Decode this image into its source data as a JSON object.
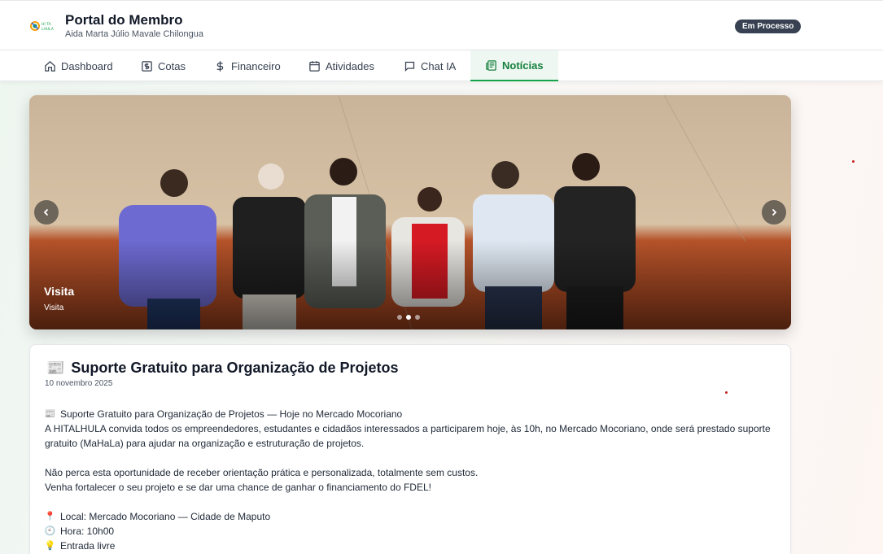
{
  "header": {
    "app_title": "Portal do Membro",
    "user_name": "Aida Marta Júlio Mavale Chilongua",
    "status": "Em Processo",
    "logo_text": "HITA LHULA"
  },
  "nav": {
    "tabs": [
      {
        "label": "Dashboard",
        "icon": "home-icon"
      },
      {
        "label": "Cotas",
        "icon": "dollar-square-icon"
      },
      {
        "label": "Financeiro",
        "icon": "dollar-icon"
      },
      {
        "label": "Atividades",
        "icon": "calendar-icon"
      },
      {
        "label": "Chat IA",
        "icon": "chat-icon"
      },
      {
        "label": "Notícias",
        "icon": "newspaper-icon",
        "active": true
      }
    ]
  },
  "carousel": {
    "title": "Visita",
    "caption": "Visita",
    "slide_count": 3,
    "active_slide": 2
  },
  "news": {
    "title": "Suporte Gratuito para Organização de Projetos",
    "date": "10 novembro 2025",
    "lines": [
      {
        "icon": "📰",
        "text": "Suporte Gratuito para Organização de Projetos — Hoje no Mercado Mocoriano"
      },
      {
        "icon": "",
        "text": "A HITALHULA convida todos os empreendedores, estudantes e cidadãos interessados a participarem hoje, às 10h, no Mercado Mocoriano, onde será prestado suporte"
      },
      {
        "icon": "",
        "text": "gratuito (MaHaLa) para ajudar na organização e estruturação de projetos."
      },
      {
        "icon": "",
        "text": ""
      },
      {
        "icon": "",
        "text": "Não perca esta oportunidade de receber orientação prática e personalizada, totalmente sem custos."
      },
      {
        "icon": "",
        "text": "Venha fortalecer o seu projeto e se dar uma chance de ganhar o financiamento do FDEL!"
      },
      {
        "icon": "",
        "text": ""
      },
      {
        "icon": "📍",
        "text": "Local: Mercado Mocoriano — Cidade de Maputo"
      },
      {
        "icon": "🕙",
        "text": "Hora: 10h00"
      },
      {
        "icon": "💡",
        "text": "Entrada livre"
      }
    ]
  },
  "colors": {
    "accent": "#16a34a",
    "badge": "#374151"
  }
}
